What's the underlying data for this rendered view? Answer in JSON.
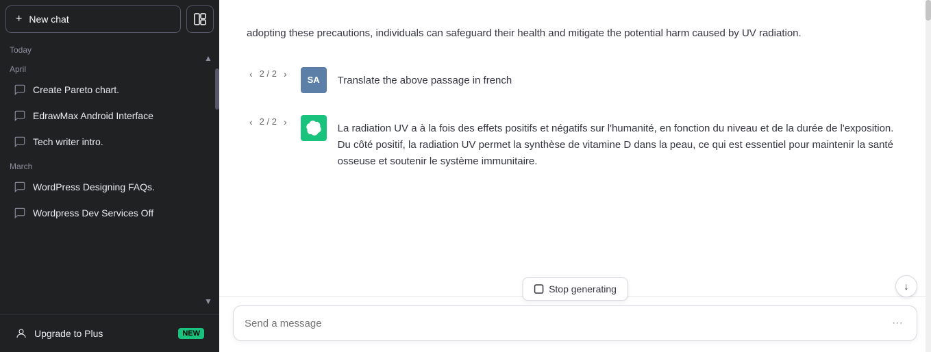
{
  "sidebar": {
    "new_chat_label": "New chat",
    "layout_icon": "⊞",
    "sections": [
      {
        "label": "Today",
        "items": []
      },
      {
        "label": "April",
        "items": [
          {
            "text": "Create Pareto chart."
          },
          {
            "text": "EdrawMax Android Interface"
          },
          {
            "text": "Tech writer intro."
          }
        ]
      },
      {
        "label": "March",
        "items": [
          {
            "text": "WordPress Designing FAQs."
          },
          {
            "text": "Wordpress Dev Services Off"
          }
        ]
      }
    ],
    "upgrade_label": "Upgrade to Plus",
    "new_badge": "NEW"
  },
  "main": {
    "scroll_down_arrow": "↓",
    "text_above": "adopting these precautions, individuals can safeguard their health and mitigate the potential harm caused by UV radiation.",
    "user_message": {
      "nav": "2 / 2",
      "avatar": "SA",
      "text": "Translate the above passage in french"
    },
    "ai_message": {
      "nav": "2 / 2",
      "text": "La radiation UV a à la fois des effets positifs et négatifs sur l'humanité, en fonction du niveau et de la durée de l'exposition. Du côté positif, la radiation UV permet la synthèse de vitamine D dans la peau, ce qui est essentiel pour maintenir la santé osseuse et soutenir le système immunitaire."
    },
    "stop_btn_label": "Stop generating",
    "input_placeholder": "Send a message",
    "input_value": ""
  }
}
